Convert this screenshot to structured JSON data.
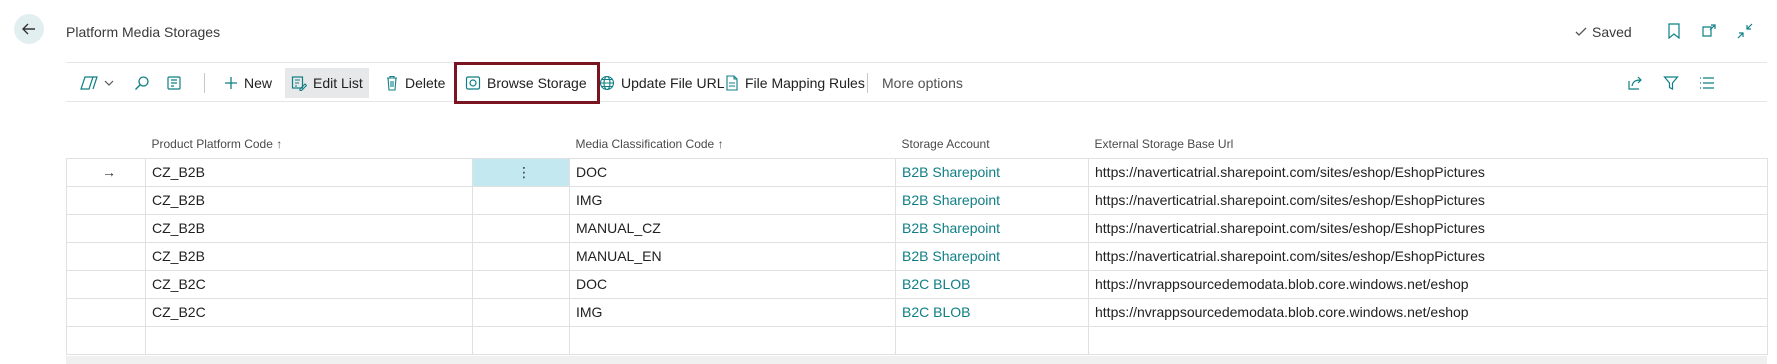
{
  "header": {
    "title": "Platform Media Storages",
    "saved_label": "Saved"
  },
  "actions": {
    "new": "New",
    "edit_list": "Edit List",
    "delete": "Delete",
    "browse_storage": "Browse Storage",
    "update_file_url": "Update File URL",
    "file_mapping_rules": "File Mapping Rules",
    "more_options": "More options"
  },
  "columns": {
    "product_platform_code": "Product Platform Code",
    "media_classification_code": "Media Classification Code",
    "storage_account": "Storage Account",
    "external_storage_base_url": "External Storage Base Url"
  },
  "rows": [
    {
      "platform": "CZ_B2B",
      "media": "DOC",
      "account": "B2B Sharepoint",
      "url": "https://naverticatrial.sharepoint.com/sites/eshop/EshopPictures"
    },
    {
      "platform": "CZ_B2B",
      "media": "IMG",
      "account": "B2B Sharepoint",
      "url": "https://naverticatrial.sharepoint.com/sites/eshop/EshopPictures"
    },
    {
      "platform": "CZ_B2B",
      "media": "MANUAL_CZ",
      "account": "B2B Sharepoint",
      "url": "https://naverticatrial.sharepoint.com/sites/eshop/EshopPictures"
    },
    {
      "platform": "CZ_B2B",
      "media": "MANUAL_EN",
      "account": "B2B Sharepoint",
      "url": "https://naverticatrial.sharepoint.com/sites/eshop/EshopPictures"
    },
    {
      "platform": "CZ_B2C",
      "media": "DOC",
      "account": "B2C BLOB",
      "url": "https://nvrappsourcedemodata.blob.core.windows.net/eshop"
    },
    {
      "platform": "CZ_B2C",
      "media": "IMG",
      "account": "B2C BLOB",
      "url": "https://nvrappsourcedemodata.blob.core.windows.net/eshop"
    }
  ],
  "colors": {
    "accent": "#0f7f85",
    "selected_cell": "#c3e8ef",
    "highlight_border": "#7a1420"
  }
}
